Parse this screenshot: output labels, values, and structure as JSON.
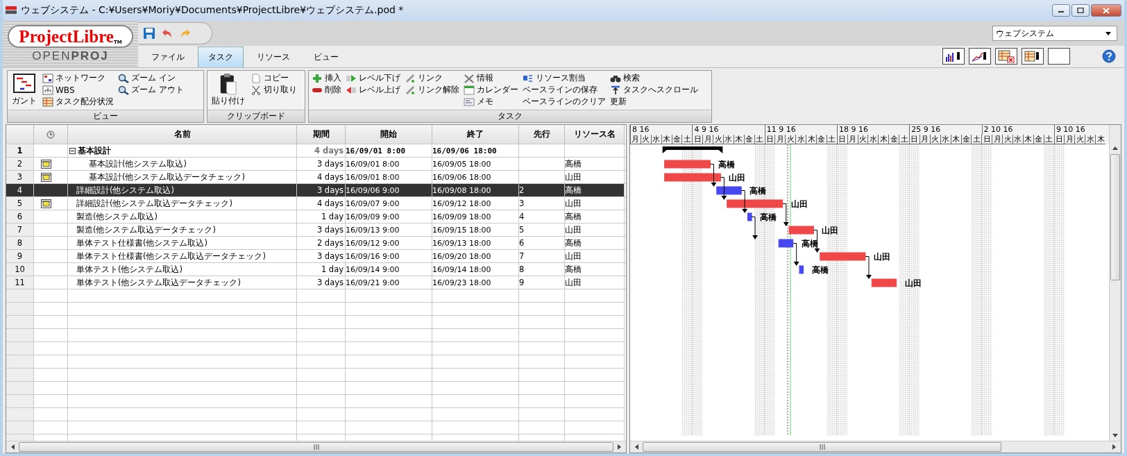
{
  "window": {
    "title": "ウェブシステム - C:¥Users¥Moriy¥Documents¥ProjectLibre¥ウェブシステム.pod *"
  },
  "logo": {
    "name": "Project**Libre**",
    "mark": "TM",
    "subtitle": "OPEN**PROJ**"
  },
  "tabs": [
    {
      "label": "ファイル",
      "selected": false
    },
    {
      "label": "タスク",
      "selected": true
    },
    {
      "label": "リソース",
      "selected": false
    },
    {
      "label": "ビュー",
      "selected": false
    }
  ],
  "project_selector": {
    "value": "ウェブシステム"
  },
  "ribbon": {
    "groups": [
      {
        "label": "ビュー",
        "columns": [
          [
            {
              "label": "ガント",
              "kind": "large"
            }
          ],
          [
            {
              "label": "ネットワーク",
              "kind": "small"
            },
            {
              "label": "WBS",
              "kind": "small"
            },
            {
              "label": "タスク配分状況",
              "kind": "small"
            }
          ],
          [
            {
              "label": "ズーム イン",
              "kind": "small"
            },
            {
              "label": "ズーム アウト",
              "kind": "small"
            }
          ]
        ]
      },
      {
        "label": "クリップボード",
        "columns": [
          [
            {
              "label": "貼り付け",
              "kind": "large"
            }
          ],
          [
            {
              "label": "コピー",
              "kind": "small"
            },
            {
              "label": "切り取り",
              "kind": "small"
            }
          ]
        ]
      },
      {
        "label": "タスク",
        "columns": [
          [
            {
              "label": "挿入",
              "kind": "small"
            },
            {
              "label": "削除",
              "kind": "small"
            }
          ],
          [
            {
              "label": "レベル下げ",
              "kind": "small"
            },
            {
              "label": "レベル上げ",
              "kind": "small"
            }
          ],
          [
            {
              "label": "リンク",
              "kind": "small"
            },
            {
              "label": "リンク解除",
              "kind": "small"
            }
          ],
          [
            {
              "label": "情報",
              "kind": "small"
            },
            {
              "label": "カレンダー",
              "kind": "small"
            },
            {
              "label": "メモ",
              "kind": "small"
            }
          ],
          [
            {
              "label": "リソース割当",
              "kind": "small"
            },
            {
              "label": "ベースラインの保存",
              "kind": "small"
            },
            {
              "label": "ベースラインのクリア",
              "kind": "small"
            }
          ],
          [
            {
              "label": "検索",
              "kind": "small"
            },
            {
              "label": "タスクへスクロール",
              "kind": "small"
            },
            {
              "label": "更新",
              "kind": "small"
            }
          ]
        ]
      }
    ]
  },
  "table": {
    "columns": [
      "名前",
      "期間",
      "開始",
      "終了",
      "先行",
      "リソース名"
    ],
    "rows": [
      {
        "num": "1",
        "kind": "summary",
        "expanded": true,
        "indicator": false,
        "selected": false,
        "name": "基本設計",
        "duration": "4 days",
        "start": "16/09/01 8:00",
        "end": "16/09/06 18:00",
        "children": [
          {
            "num": "2",
            "kind": "task",
            "indicator": true,
            "selected": false,
            "name": "基本設計(他システム取込)",
            "duration": "3 days",
            "start": "16/09/01 8:00",
            "end": "16/09/05 18:00",
            "resource": "高橋",
            "color": "#f04848",
            "bar_label": "高橋"
          },
          {
            "num": "3",
            "kind": "task",
            "indicator": true,
            "selected": false,
            "name": "基本設計(他システム取込データチェック)",
            "duration": "4 days",
            "start": "16/09/01 8:00",
            "end": "16/09/06 18:00",
            "resource": "山田",
            "color": "#f04848",
            "bar_label": "山田"
          }
        ]
      },
      {
        "num": "4",
        "kind": "task",
        "indicator": false,
        "selected": true,
        "name": "詳細設計(他システム取込)",
        "duration": "3 days",
        "start": "16/09/06 9:00",
        "end": "16/09/08 18:00",
        "predecessors": "2",
        "resource": "高橋",
        "color": "#4848f0",
        "bar_label": "高橋"
      },
      {
        "num": "5",
        "kind": "task",
        "indicator": true,
        "selected": false,
        "name": "詳細設計(他システム取込データチェック)",
        "duration": "4 days",
        "start": "16/09/07 9:00",
        "end": "16/09/12 18:00",
        "predecessors": "3",
        "resource": "山田",
        "color": "#f04848",
        "bar_label": "山田"
      },
      {
        "num": "6",
        "kind": "task",
        "indicator": false,
        "selected": false,
        "name": "製造(他システム取込)",
        "duration": "1 day",
        "start": "16/09/09 9:00",
        "end": "16/09/09 18:00",
        "predecessors": "4",
        "resource": "高橋",
        "color": "#4848f0",
        "bar_label": "高橋"
      },
      {
        "num": "7",
        "kind": "task",
        "indicator": false,
        "selected": false,
        "name": "製造(他システム取込データチェック)",
        "duration": "3 days",
        "start": "16/09/13 9:00",
        "end": "16/09/15 18:00",
        "predecessors": "5",
        "resource": "山田",
        "color": "#f04848",
        "bar_label": "山田"
      },
      {
        "num": "8",
        "kind": "task",
        "indicator": false,
        "selected": false,
        "name": "単体テスト仕様書(他システム取込)",
        "duration": "2 days",
        "start": "16/09/12 9:00",
        "end": "16/09/13 18:00",
        "predecessors": "6",
        "resource": "高橋",
        "color": "#4848f0",
        "bar_label": "高橋"
      },
      {
        "num": "9",
        "kind": "task",
        "indicator": false,
        "selected": false,
        "name": "単体テスト仕様書(他システム取込データチェック)",
        "duration": "3 days",
        "start": "16/09/16 9:00",
        "end": "16/09/20 18:00",
        "predecessors": "7",
        "resource": "山田",
        "color": "#f04848",
        "bar_label": "山田"
      },
      {
        "num": "10",
        "kind": "task",
        "indicator": false,
        "selected": false,
        "name": "単体テスト(他システム取込)",
        "duration": "1 day",
        "start": "16/09/14 9:00",
        "end": "16/09/14 18:00",
        "predecessors": "8",
        "resource": "高橋",
        "color": "#4848f0",
        "bar_label": "高橋"
      },
      {
        "num": "11",
        "kind": "task",
        "indicator": false,
        "selected": false,
        "name": "単体テスト(他システム取込データチェック)",
        "duration": "3 days",
        "start": "16/09/21 9:00",
        "end": "16/09/23 18:00",
        "predecessors": "9",
        "resource": "山田",
        "color": "#f04848",
        "bar_label": "山田"
      }
    ]
  },
  "gantt": {
    "weeks": [
      "8 16",
      "4 9 16",
      "11 9 16",
      "18 9 16",
      "25 9 16",
      "2 10 16",
      "9 10 16"
    ],
    "days": [
      "月",
      "火",
      "水",
      "木",
      "金",
      "土",
      "日",
      "月",
      "火",
      "水",
      "木",
      "金",
      "土",
      "日",
      "月",
      "火",
      "水",
      "木",
      "金",
      "土",
      "日",
      "月",
      "火",
      "水",
      "木",
      "金",
      "土",
      "日",
      "月",
      "火",
      "水",
      "木",
      "金",
      "土",
      "日",
      "月",
      "火",
      "水",
      "木",
      "金",
      "土",
      "日",
      "月",
      "火",
      "水",
      "木"
    ]
  }
}
